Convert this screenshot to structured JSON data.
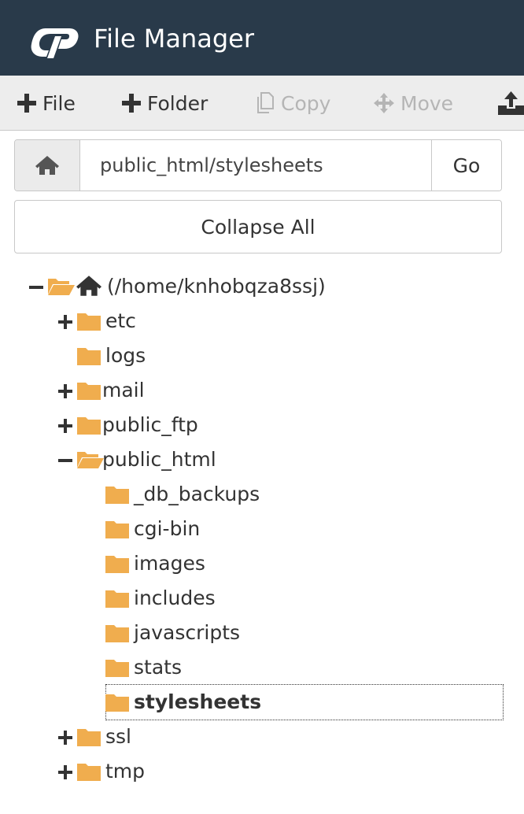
{
  "app": {
    "title": "File Manager",
    "logo": "cpanel-logo"
  },
  "toolbar": {
    "file_label": "File",
    "folder_label": "Folder",
    "copy_label": "Copy",
    "move_label": "Move",
    "icons": {
      "file": "plus-icon",
      "folder": "plus-icon",
      "copy": "copy-icon",
      "move": "move-icon",
      "upload": "upload-icon"
    }
  },
  "pathbar": {
    "value": "public_html/stylesheets",
    "go_label": "Go",
    "home_icon": "home-icon"
  },
  "collapse_label": "Collapse All",
  "tree": {
    "root_label": "(/home/knhobqza8ssj)",
    "nodes": {
      "etc": "etc",
      "logs": "logs",
      "mail": "mail",
      "public_ftp": "public_ftp",
      "public_html": "public_html",
      "db_backups": "_db_backups",
      "cgi_bin": "cgi-bin",
      "images": "images",
      "includes": "includes",
      "javascripts": "javascripts",
      "stats": "stats",
      "stylesheets": "stylesheets",
      "ssl": "ssl",
      "tmp": "tmp"
    },
    "selected": "stylesheets"
  },
  "colors": {
    "header_bg": "#293a4a",
    "toolbar_bg": "#ededed",
    "folder": "#f0ad4e",
    "text": "#333333",
    "disabled": "#b5b5b5"
  }
}
